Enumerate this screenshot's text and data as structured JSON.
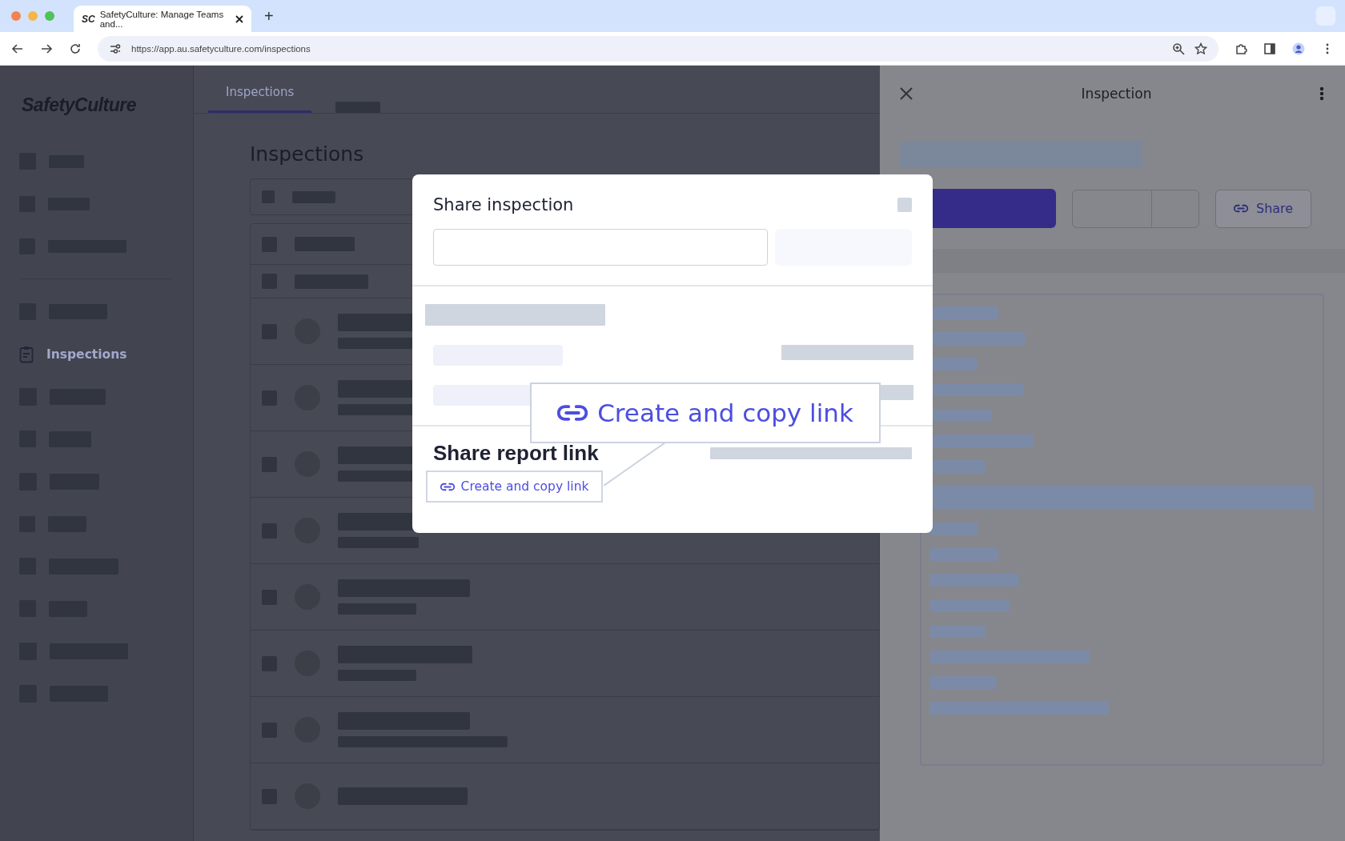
{
  "browser": {
    "favicon": "SC",
    "tab_title": "SafetyCulture: Manage Teams and...",
    "new_tab": "+",
    "url": "https://app.au.safetyculture.com/inspections"
  },
  "sidebar": {
    "logo": "SafetyCulture",
    "items": [
      {
        "label": "Inspections",
        "selected": true
      }
    ]
  },
  "main": {
    "tabs": [
      {
        "label": "Inspections",
        "selected": true
      }
    ],
    "heading": "Inspections"
  },
  "panel": {
    "title": "Inspection",
    "share_button": "Share"
  },
  "modal": {
    "title": "Share inspection",
    "section_title": "Share report link",
    "button": "Create and copy link"
  },
  "callout": {
    "label": "Create and copy link"
  }
}
